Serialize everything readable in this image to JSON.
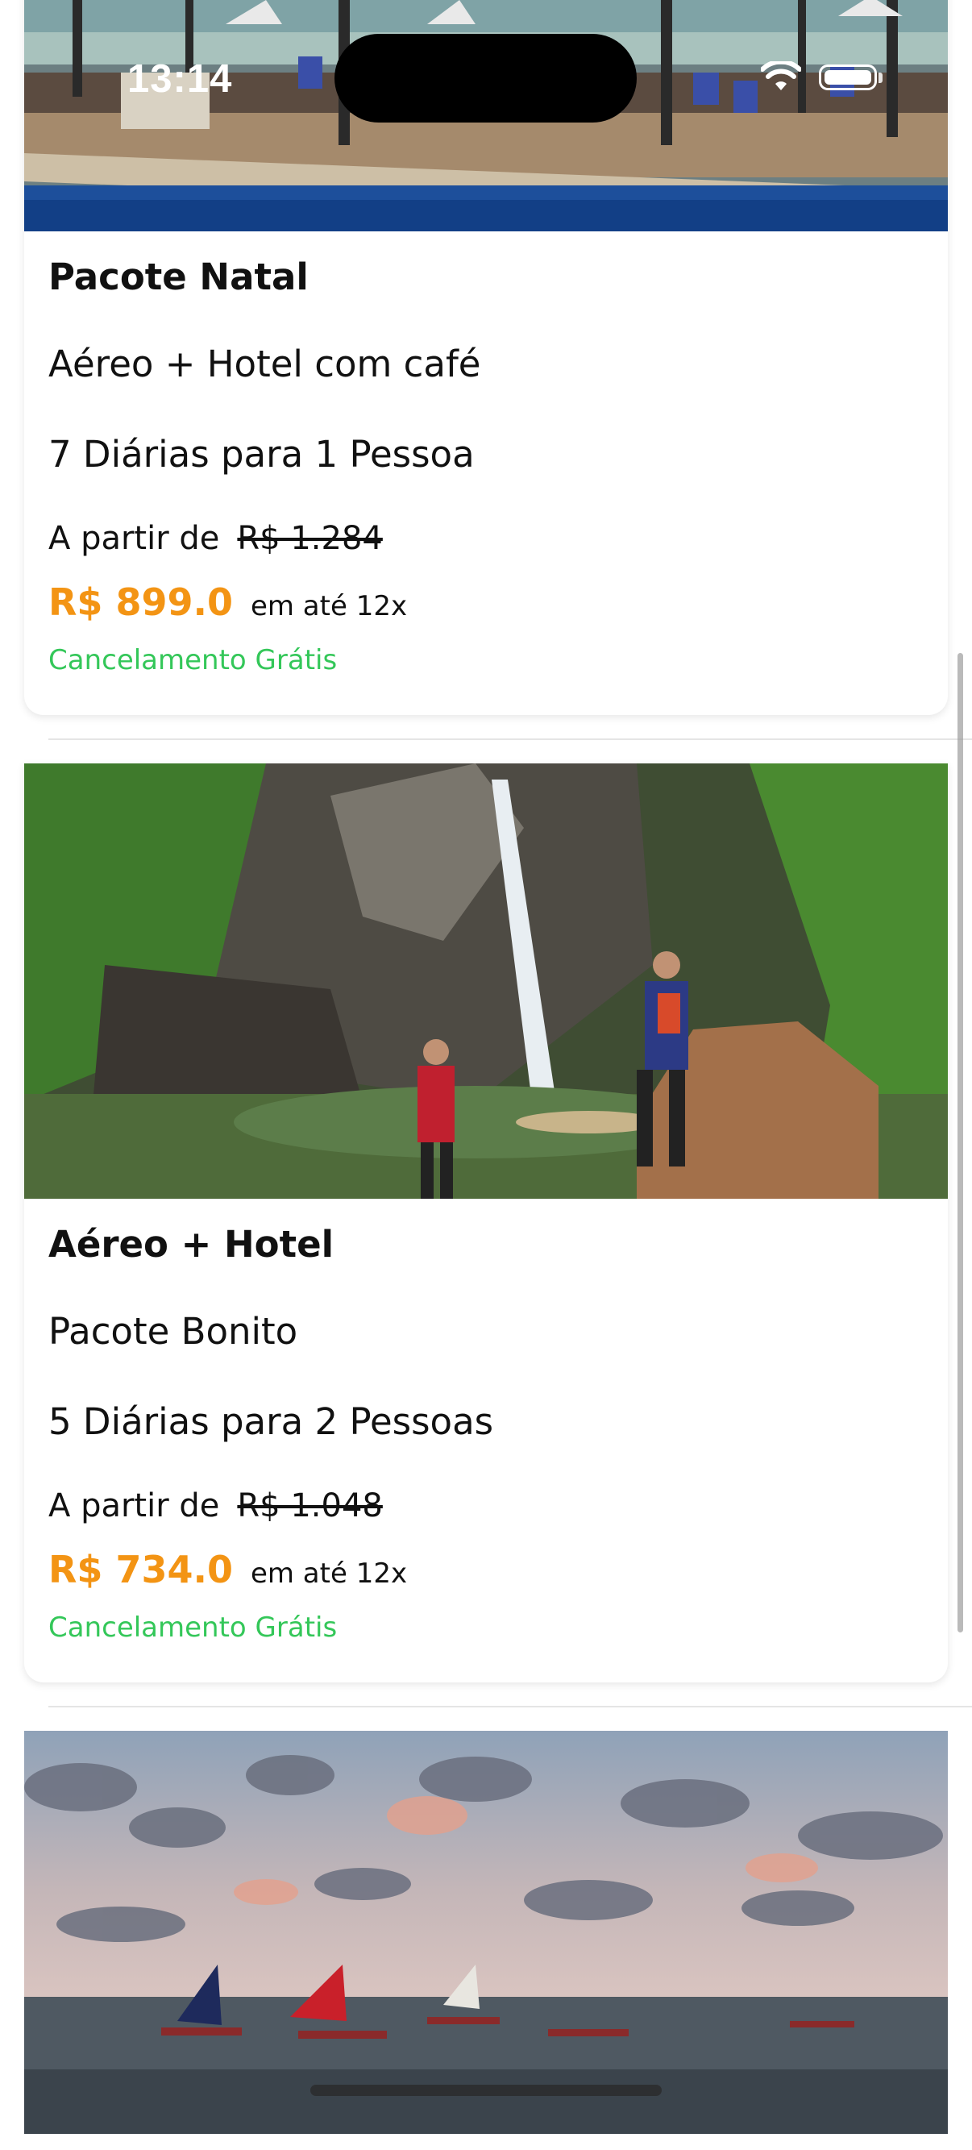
{
  "status_bar": {
    "time": "13:14"
  },
  "colors": {
    "price": "#f39414",
    "free_cancel": "#34c759",
    "divider": "#e5e5e5"
  },
  "cards": [
    {
      "title": "Pacote Natal",
      "line2": "Aéreo + Hotel com café",
      "line3": "7 Diárias para 1 Pessoa",
      "from_label": "A partir de",
      "old_price": "R$ 1.284",
      "price": "R$ 899.0",
      "installments": "em até 12x",
      "cancellation": "Cancelamento Grátis"
    },
    {
      "title": "Aéreo + Hotel",
      "line2": "Pacote Bonito",
      "line3": "5 Diárias para 2 Pessoas",
      "from_label": "A partir de",
      "old_price": "R$ 1.048",
      "price": "R$ 734.0",
      "installments": "em até 12x",
      "cancellation": "Cancelamento Grátis"
    }
  ]
}
